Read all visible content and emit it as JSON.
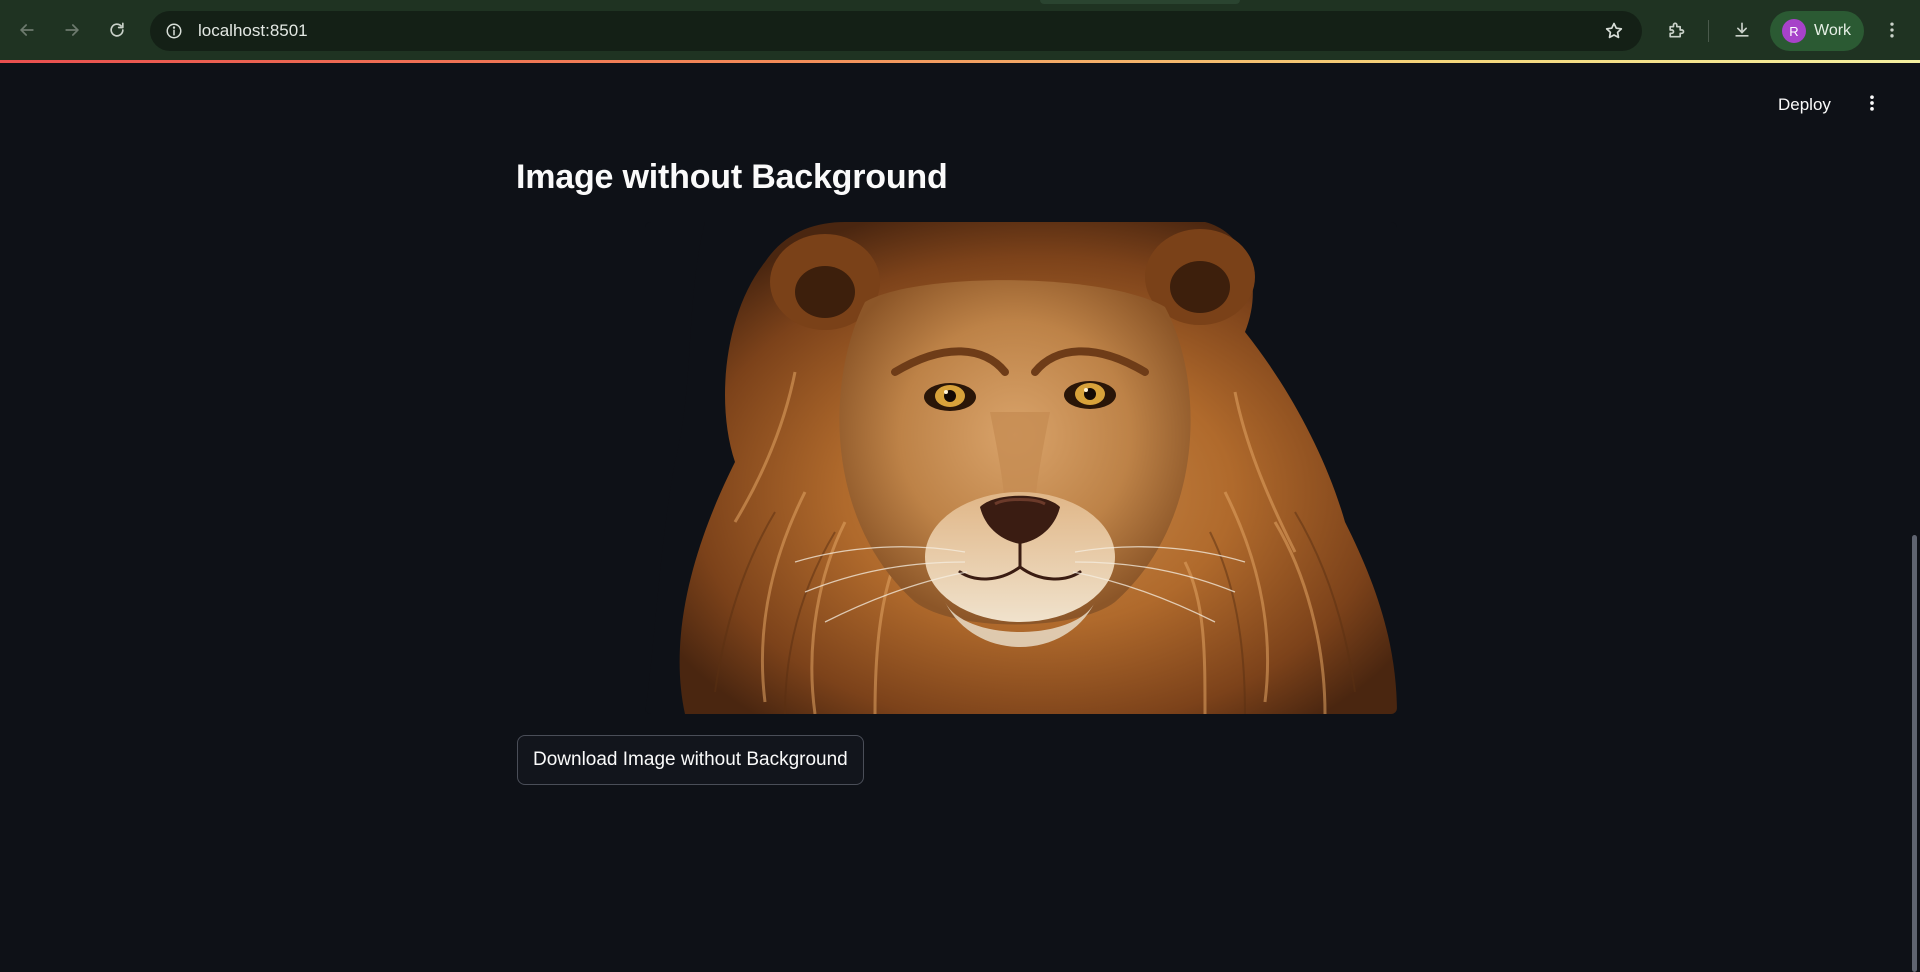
{
  "browser": {
    "url": "localhost:8501",
    "profile_initial": "R",
    "profile_name": "Work",
    "profile_color": "#a742c9",
    "chrome_color": "#1f3322"
  },
  "header": {
    "deploy_label": "Deploy"
  },
  "main": {
    "title": "Image without Background",
    "image_subject": "lion portrait with removed background",
    "download_label": "Download Image without Background"
  },
  "theme": {
    "background": "#0e1117",
    "text": "#fafafa"
  },
  "icons": {
    "back": "arrow-left-icon",
    "forward": "arrow-right-icon",
    "reload": "reload-icon",
    "site_info": "info-icon",
    "bookmark": "star-icon",
    "extensions": "puzzle-icon",
    "downloads": "download-icon",
    "browser_menu": "kebab-menu-icon",
    "app_menu": "kebab-menu-icon"
  }
}
